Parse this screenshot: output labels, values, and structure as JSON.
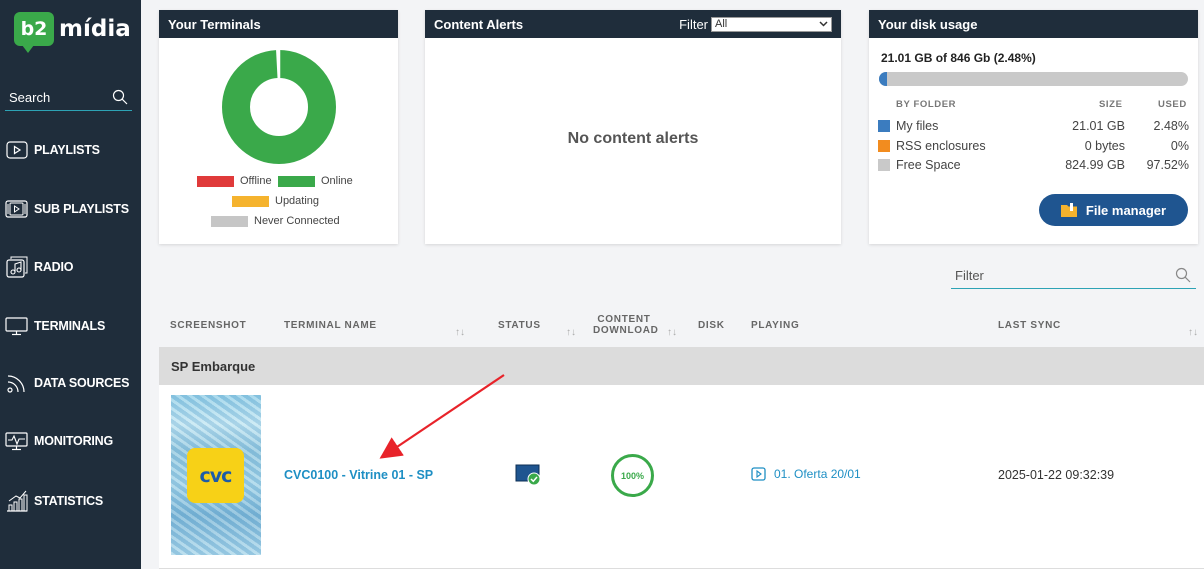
{
  "brand": {
    "logo_mark": "b2",
    "logo_text": "mídia"
  },
  "sidebar": {
    "search_label": "Search",
    "items": [
      {
        "label": "PLAYLISTS",
        "icon": "play-square-icon"
      },
      {
        "label": "SUB PLAYLISTS",
        "icon": "stacked-playlist-icon"
      },
      {
        "label": "RADIO",
        "icon": "music-note-icon"
      },
      {
        "label": "TERMINALS",
        "icon": "monitor-icon"
      },
      {
        "label": "DATA SOURCES",
        "icon": "rss-icon"
      },
      {
        "label": "MONITORING",
        "icon": "pulse-monitor-icon"
      },
      {
        "label": "STATISTICS",
        "icon": "bar-chart-icon"
      }
    ]
  },
  "terminals_card": {
    "title": "Your Terminals",
    "legend": {
      "offline": "Offline",
      "online": "Online",
      "updating": "Updating",
      "never": "Never Connected"
    },
    "online_fraction": 0.99,
    "colors": {
      "offline": "#e03a3a",
      "online": "#3aa94a",
      "updating": "#f5b32e",
      "never": "#c6c6c6"
    }
  },
  "alerts_card": {
    "title": "Content Alerts",
    "filter_label": "Filter",
    "filter_value": "All",
    "empty_message": "No content alerts"
  },
  "disk_card": {
    "title": "Your disk usage",
    "summary": "21.01 GB of 846 Gb (2.48%)",
    "used_percent": 2.48,
    "columns": {
      "folder": "BY FOLDER",
      "size": "SIZE",
      "used": "USED"
    },
    "rows": [
      {
        "name": "My files",
        "size": "21.01 GB",
        "used": "2.48%",
        "color": "#3b7cbf"
      },
      {
        "name": "RSS enclosures",
        "size": "0 bytes",
        "used": "0%",
        "color": "#f28c1f"
      },
      {
        "name": "Free Space",
        "size": "824.99 GB",
        "used": "97.52%",
        "color": "#c9c9c9"
      }
    ],
    "button_label": "File manager"
  },
  "list": {
    "filter_placeholder": "Filter",
    "columns": {
      "screenshot": "SCREENSHOT",
      "terminal_name": "TERMINAL NAME",
      "status": "STATUS",
      "content_download_1": "CONTENT",
      "content_download_2": "DOWNLOAD",
      "disk": "DISK",
      "playing": "PLAYING",
      "last_sync": "LAST SYNC"
    },
    "sort_glyph": "↑↓",
    "group": "SP Embarque",
    "rows": [
      {
        "thumb_text": "cvc",
        "name": "CVC0100 - Vitrine 01 - SP",
        "download": "100%",
        "playing": "01. Oferta 20/01",
        "last_sync": "2025-01-22 09:32:39"
      }
    ]
  }
}
